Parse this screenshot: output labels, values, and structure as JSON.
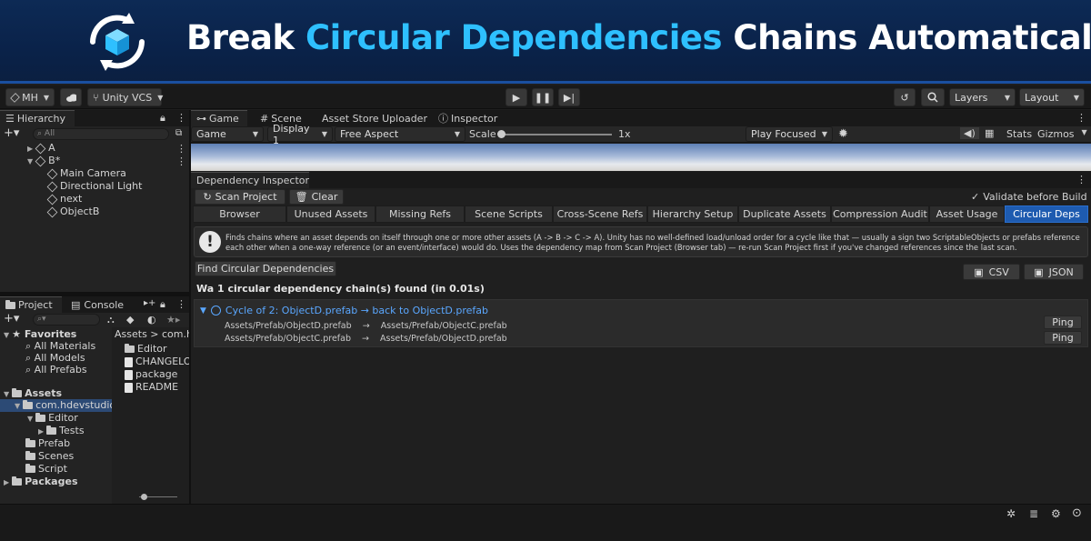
{
  "banner": {
    "title_part1": "Break ",
    "title_highlight": "Circular Dependencies",
    "title_part2": " Chains Automatically"
  },
  "toolbar": {
    "account": "MH",
    "vcs": "Unity VCS",
    "layers": "Layers",
    "layout": "Layout"
  },
  "hierarchy": {
    "tab": "Hierarchy",
    "search_placeholder": "All",
    "items": [
      {
        "label": "A"
      },
      {
        "label": "B*"
      },
      {
        "label": "Main Camera"
      },
      {
        "label": "Directional Light"
      },
      {
        "label": "next"
      },
      {
        "label": "ObjectB"
      }
    ]
  },
  "project": {
    "tab_project": "Project",
    "tab_console": "Console",
    "favorites": "Favorites",
    "fav_items": [
      "All Materials",
      "All Models",
      "All Prefabs"
    ],
    "assets": "Assets",
    "assets_tree": [
      "com.hdevstudio.",
      "Editor",
      "Tests",
      "Prefab",
      "Scenes",
      "Script"
    ],
    "packages": "Packages",
    "breadcrumb": "Assets > com.hdev",
    "files": [
      "Editor",
      "CHANGELOG",
      "package",
      "README"
    ]
  },
  "game_tabs": {
    "game": "Game",
    "scene": "Scene",
    "asset_store": "Asset Store Uploader",
    "inspector": "Inspector"
  },
  "game_bar": {
    "display_mode": "Game",
    "display": "Display 1",
    "aspect": "Free Aspect",
    "scale_label": "Scale",
    "scale_value": "1x",
    "play_mode": "Play Focused",
    "stats": "Stats",
    "gizmos": "Gizmos"
  },
  "dependency_inspector": {
    "title": "Dependency Inspector",
    "scan_button": "Scan Project",
    "clear_button": "Clear",
    "validate_label": "Validate before Build",
    "validate_checked": true,
    "tabs": [
      "Browser",
      "Unused Assets",
      "Missing Refs",
      "Scene Scripts",
      "Cross-Scene Refs",
      "Hierarchy Setup",
      "Duplicate Assets",
      "Compression Audit",
      "Asset Usage",
      "Circular Deps"
    ],
    "active_tab": "Circular Deps",
    "info_text_line1": "Finds chains where an asset depends on itself through one or more other assets (A -> B -> C -> A). Unity has no well-defined load/unload order for a cycle like that — usually a sign two ScriptableObjects or prefabs reference",
    "info_text_line2": "each other when a one-way reference (or an event/interface) would do. Uses the dependency map from Scan Project (Browser tab) — re-run Scan Project first if you've changed references since the last scan.",
    "find_button": "Find Circular Dependencies",
    "csv_button": "CSV",
    "json_button": "JSON",
    "result_summary": "Wa 1 circular dependency chain(s) found (in 0.01s)",
    "cycle_title": "Cycle of 2: ObjectD.prefab  →  back to ObjectD.prefab",
    "cycle_rows": [
      {
        "from": "Assets/Prefab/ObjectD.prefab",
        "arrow": "→",
        "to": "Assets/Prefab/ObjectC.prefab",
        "ping": "Ping"
      },
      {
        "from": "Assets/Prefab/ObjectC.prefab",
        "arrow": "→",
        "to": "Assets/Prefab/ObjectD.prefab",
        "ping": "Ping"
      }
    ]
  },
  "colors": {
    "banner_bg": "#0b2450",
    "highlight": "#2ec0ff",
    "active_tab": "#1e5bb0",
    "link": "#5aa7ff"
  }
}
